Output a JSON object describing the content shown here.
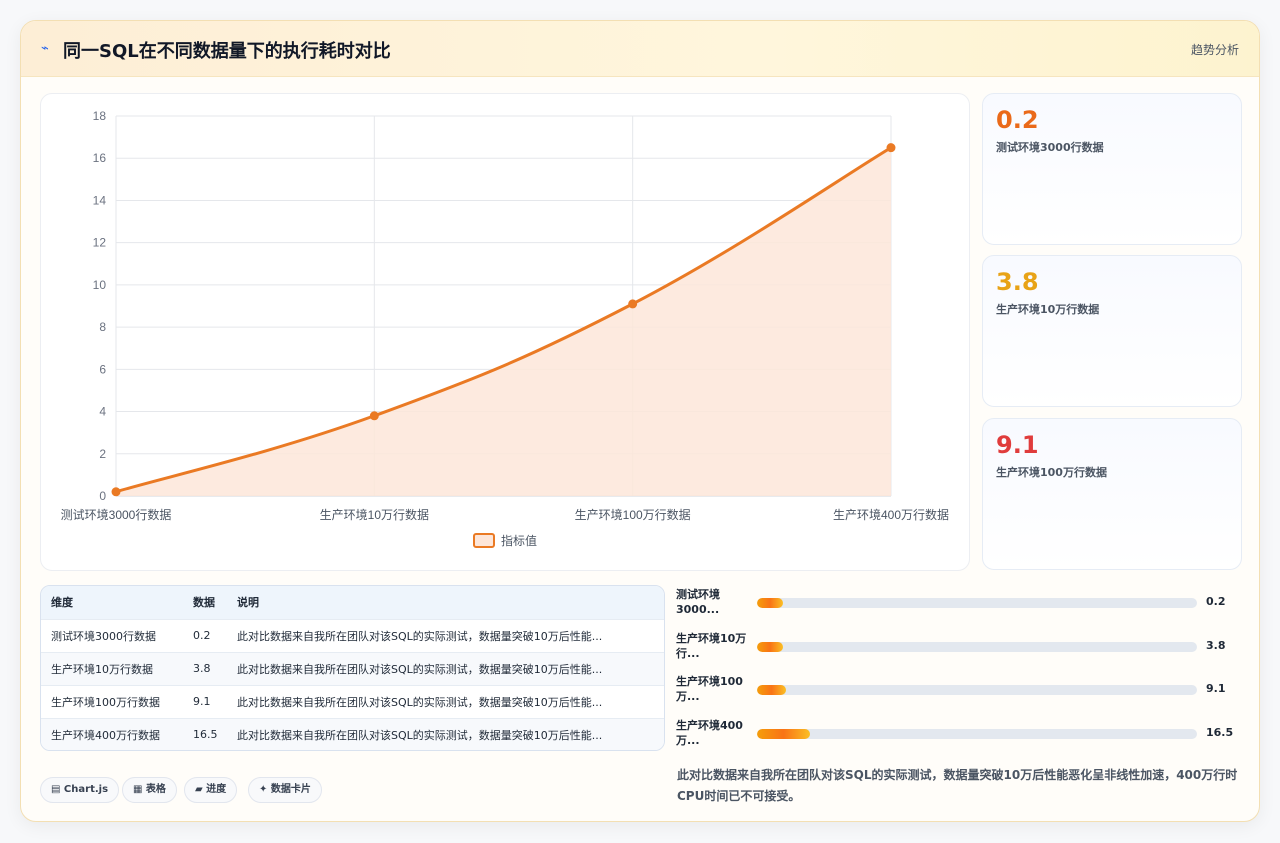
{
  "header": {
    "icon": "chart-line-icon",
    "title": "同一SQL在不同数据量下的执行耗时对比",
    "tag": "趋势分析"
  },
  "chart_data": {
    "type": "line",
    "categories": [
      "测试环境3000行数据",
      "生产环境10万行数据",
      "生产环境100万行数据",
      "生产环境400万行数据"
    ],
    "series": [
      {
        "name": "指标值",
        "values": [
          0.2,
          3.8,
          9.1,
          16.5
        ],
        "color": "#ea7a24"
      }
    ],
    "ylim": [
      0,
      18
    ],
    "yticks": [
      0,
      2,
      4,
      6,
      8,
      10,
      12,
      14,
      16,
      18
    ],
    "grid": true,
    "legend": "bottom",
    "fill": "#fde6d9"
  },
  "stats": [
    {
      "value": "0.2",
      "label": "测试环境3000行数据",
      "color": "#ea6a1a"
    },
    {
      "value": "3.8",
      "label": "生产环境10万行数据",
      "color": "#e8a317"
    },
    {
      "value": "9.1",
      "label": "生产环境100万行数据",
      "color": "#e03c3c"
    }
  ],
  "table": {
    "headers": [
      "维度",
      "数据",
      "说明"
    ],
    "rows": [
      [
        "测试环境3000行数据",
        "0.2",
        "此对比数据来自我所在团队对该SQL的实际测试，数据量突破10万后性能..."
      ],
      [
        "生产环境10万行数据",
        "3.8",
        "此对比数据来自我所在团队对该SQL的实际测试，数据量突破10万后性能..."
      ],
      [
        "生产环境100万行数据",
        "9.1",
        "此对比数据来自我所在团队对该SQL的实际测试，数据量突破10万后性能..."
      ],
      [
        "生产环境400万行数据",
        "16.5",
        "此对比数据来自我所在团队对该SQL的实际测试，数据量突破10万后性能..."
      ]
    ]
  },
  "progress": {
    "max": 165,
    "items": [
      {
        "label": "测试环境3000...",
        "value": "0.2",
        "fraction": 0.06
      },
      {
        "label": "生产环境10万行...",
        "value": "3.8",
        "fraction": 0.06
      },
      {
        "label": "生产环境100万...",
        "value": "9.1",
        "fraction": 0.065
      },
      {
        "label": "生产环境400万...",
        "value": "16.5",
        "fraction": 0.12
      }
    ]
  },
  "chips": [
    "▤ Chart.js",
    "▦ 表格",
    "▰ 进度",
    "✦ 数据卡片"
  ],
  "note": "此对比数据来自我所在团队对该SQL的实际测试，数据量突破10万后性能恶化呈非线性加速，400万行时CPU时间已不可接受。"
}
